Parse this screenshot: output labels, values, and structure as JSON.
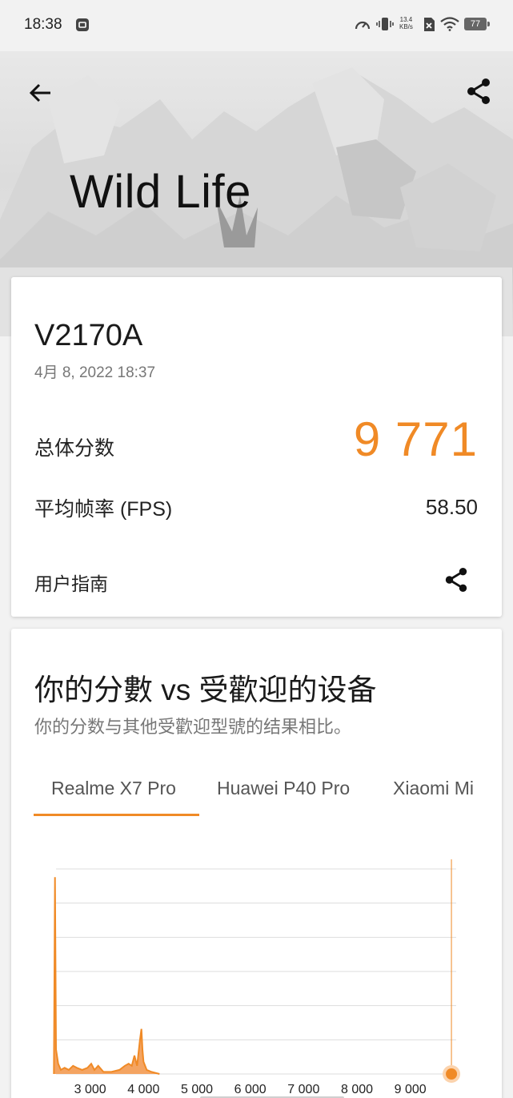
{
  "status_bar": {
    "time": "18:38",
    "net_speed_value": "13.4",
    "net_speed_unit": "KB/s",
    "battery": "77",
    "icons": [
      "gallery-notification-icon",
      "speedometer-icon",
      "vibrate-icon",
      "sim-off-icon",
      "wifi-icon",
      "battery-icon"
    ]
  },
  "header": {
    "title": "Wild Life",
    "back_icon": "arrow-left-icon",
    "share_icon": "share-icon"
  },
  "result": {
    "device": "V2170A",
    "date": "4月 8, 2022 18:37",
    "overall_label": "总体分数",
    "overall_score": "9 771",
    "fps_label": "平均帧率 (FPS)",
    "fps_value": "58.50",
    "guide_label": "用户指南",
    "accent_color": "#f08a26"
  },
  "compare": {
    "title": "你的分數 vs 受歡迎的设备",
    "subtitle": "你的分数与其他受歡迎型號的结果相比。",
    "tabs": [
      {
        "label": "Realme X7 Pro",
        "active": true
      },
      {
        "label": "Huawei P40 Pro",
        "active": false
      },
      {
        "label": "Xiaomi Mi",
        "active": false
      }
    ]
  },
  "chart_data": {
    "type": "area",
    "x_ticks": [
      "3 000",
      "4 000",
      "5 000",
      "6 000",
      "7 000",
      "8 000",
      "9 000"
    ],
    "xlim": [
      2300,
      9800
    ],
    "ylim": [
      0,
      1
    ],
    "grid": true,
    "your_score": 9771,
    "distribution": [
      [
        2320,
        0
      ],
      [
        2340,
        0.96
      ],
      [
        2360,
        0.12
      ],
      [
        2400,
        0.05
      ],
      [
        2450,
        0.02
      ],
      [
        2520,
        0.03
      ],
      [
        2600,
        0.02
      ],
      [
        2680,
        0.04
      ],
      [
        2750,
        0.03
      ],
      [
        2850,
        0.02
      ],
      [
        2950,
        0.03
      ],
      [
        3020,
        0.05
      ],
      [
        3080,
        0.02
      ],
      [
        3150,
        0.04
      ],
      [
        3250,
        0.01
      ],
      [
        3400,
        0.01
      ],
      [
        3550,
        0.02
      ],
      [
        3650,
        0.04
      ],
      [
        3720,
        0.05
      ],
      [
        3780,
        0.04
      ],
      [
        3830,
        0.09
      ],
      [
        3880,
        0.04
      ],
      [
        3930,
        0.16
      ],
      [
        3960,
        0.22
      ],
      [
        3980,
        0.12
      ],
      [
        4000,
        0.06
      ],
      [
        4060,
        0.02
      ],
      [
        4150,
        0.01
      ],
      [
        4300,
        0
      ]
    ],
    "fill_color": "#f4a462"
  }
}
